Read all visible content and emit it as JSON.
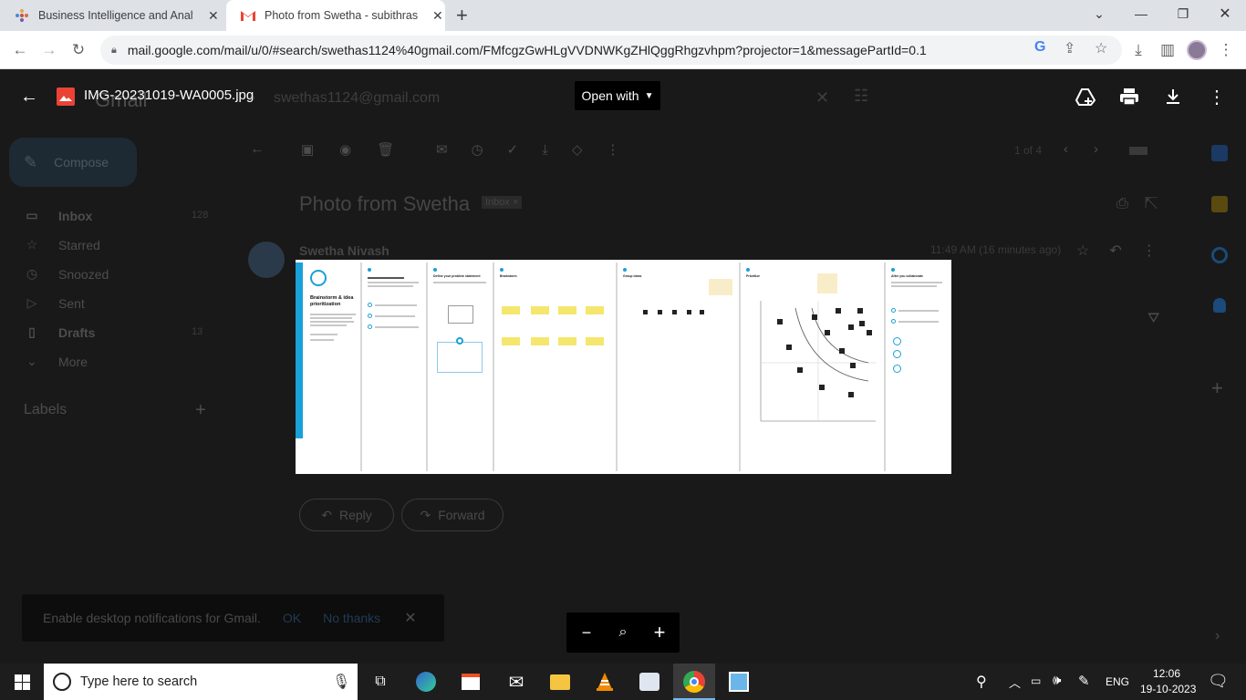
{
  "browser": {
    "tabs": [
      {
        "title": "Business Intelligence and Analyti",
        "active": false
      },
      {
        "title": "Photo from Swetha - subithrasu",
        "active": true
      }
    ],
    "url": "mail.google.com/mail/u/0/#search/swethas1124%40gmail.com/FMfcgzGwHLgVVDNWKgZHlQggRhgzvhpm?projector=1&messagePartId=0.1"
  },
  "gmail": {
    "search_value": "swethas1124@gmail.com",
    "logo": "Gmail",
    "compose_label": "Compose",
    "nav": [
      {
        "label": "Inbox",
        "count": "128",
        "icon": "inbox-icon"
      },
      {
        "label": "Starred",
        "count": "",
        "icon": "star-icon"
      },
      {
        "label": "Snoozed",
        "count": "",
        "icon": "clock-icon"
      },
      {
        "label": "Sent",
        "count": "",
        "icon": "send-icon"
      },
      {
        "label": "Drafts",
        "count": "13",
        "icon": "draft-icon"
      },
      {
        "label": "More",
        "count": "",
        "icon": "chevron-down-icon"
      }
    ],
    "labels_header": "Labels",
    "pagination": "1 of 4",
    "subject": "Photo from Swetha",
    "inbox_chip": "Inbox",
    "sender": "Swetha Nivash",
    "time": "11:49 AM (16 minutes ago)",
    "reply_label": "Reply",
    "forward_label": "Forward"
  },
  "viewer": {
    "file_name": "IMG-20231019-WA0005.jpg",
    "open_with_label": "Open with",
    "image_texts": {
      "p1_title": "Brainstorm & idea prioritization",
      "p2_title": "Define your problem statement",
      "p3_title": "Brainstorm",
      "p4_title": "Group ideas",
      "p5_title": "Prioritize",
      "p6_title": "After you collaborate"
    }
  },
  "toast": {
    "text": "Enable desktop notifications for Gmail.",
    "ok": "OK",
    "no_thanks": "No thanks"
  },
  "taskbar": {
    "search_placeholder": "Type here to search",
    "language": "ENG",
    "time": "12:06",
    "date": "19-10-2023"
  },
  "colors": {
    "accent_blue": "#1aa0d8",
    "sticky_yellow": "#f5e66e",
    "gmail_red": "#ea4335",
    "chrome_tab_bg": "#dee1e6"
  }
}
